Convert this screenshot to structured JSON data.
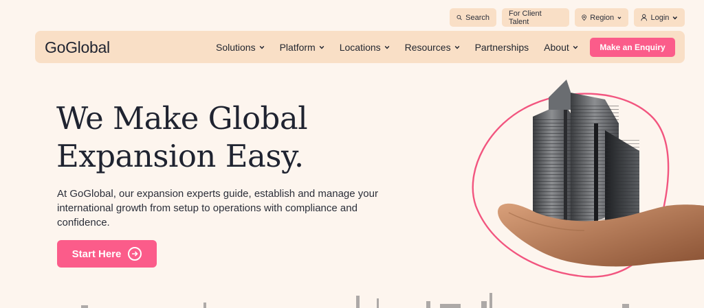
{
  "utility": {
    "search": "Search",
    "client_talent": "For Client Talent",
    "region": "Region",
    "login": "Login"
  },
  "nav": {
    "logo": "GoGlobal",
    "items": [
      {
        "label": "Solutions",
        "dropdown": true
      },
      {
        "label": "Platform",
        "dropdown": true
      },
      {
        "label": "Locations",
        "dropdown": true
      },
      {
        "label": "Resources",
        "dropdown": true
      },
      {
        "label": "Partnerships",
        "dropdown": false
      },
      {
        "label": "About",
        "dropdown": true
      }
    ],
    "cta": "Make an Enquiry"
  },
  "hero": {
    "headline_line1": "We Make Global",
    "headline_line2": "Expansion Easy.",
    "subtext": "At GoGlobal, our expansion experts guide, establish and manage your international growth from setup to operations with compliance and confidence.",
    "start_button": "Start Here"
  },
  "colors": {
    "background": "#fdf5ee",
    "nav_bg": "#f9dfc6",
    "accent": "#fb5c8a",
    "text": "#1f2330"
  },
  "icons": {
    "search": "search-icon",
    "region": "location-pin-icon",
    "login": "user-icon",
    "dropdown": "chevron-down-icon",
    "start": "arrow-right-circle-icon"
  }
}
